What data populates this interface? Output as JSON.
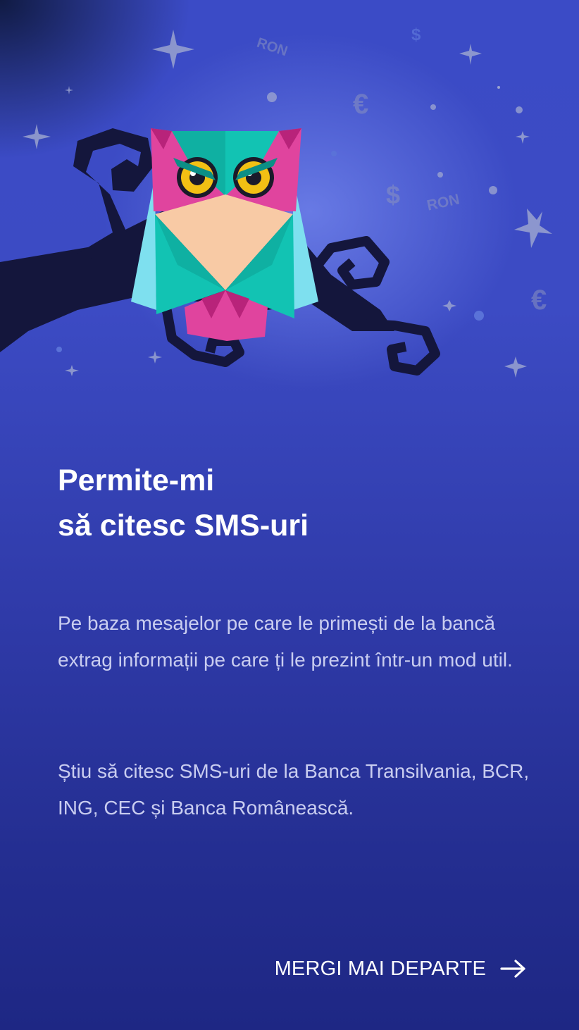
{
  "onboarding": {
    "title_line1": "Permite-mi",
    "title_line2": "să citesc SMS-uri",
    "paragraph1": "Pe baza mesajelor pe care le primești de la bancă extrag informații pe care ți le prezint într-un mod util.",
    "paragraph2": "Știu să citesc SMS-uri de la Banca Transilvania, BCR, ING, CEC și Banca Românească.",
    "next_label": "MERGI MAI DEPARTE",
    "next_icon": "arrow-right-icon"
  },
  "background_symbols": {
    "ron_top": "RON",
    "ron_right": "RON",
    "dollar_top": "$",
    "dollar_mid": "$",
    "euro_top": "€",
    "euro_right": "€"
  },
  "colors": {
    "background_top": "#3b4bc6",
    "background_bottom": "#1e2784",
    "owl_teal": "#12c3b3",
    "owl_pink": "#e0449e",
    "owl_face": "#f8caa5",
    "owl_eye": "#f2c014",
    "branch": "#14163c"
  }
}
